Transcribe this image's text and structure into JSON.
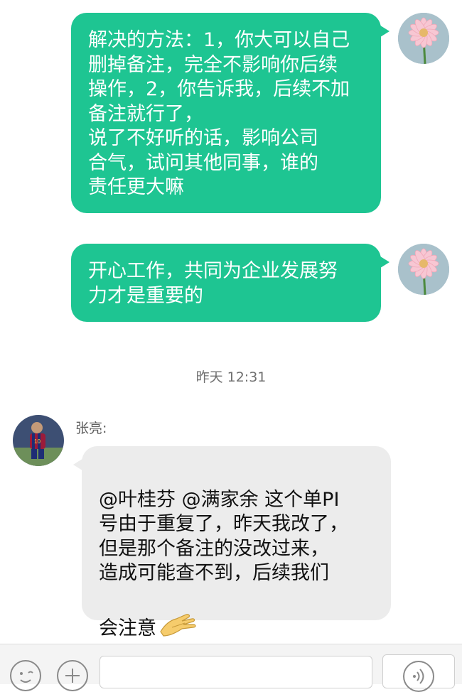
{
  "messages": [
    {
      "type": "outgoing",
      "text": "解决的方法：1，你大可以自己\n删掉备注，完全不影响你后续\n操作，2，你告诉我，后续不加\n备注就行了，\n说了不好听的话，影响公司\n合气，试问其他同事，谁的\n责任更大嘛"
    },
    {
      "type": "outgoing",
      "text": "开心工作，共同为企业发展努\n力才是重要的"
    }
  ],
  "timestamp": "昨天 12:31",
  "incoming": {
    "sender": "张亮:",
    "text_main": "@叶桂芬 @满家余 这个单PI\n号由于重复了，昨天我改了，\n但是那个备注的没改过来，\n造成可能查不到，后续我们\n",
    "text_tail": "会注意",
    "emoji": "handshake-emoji"
  },
  "toolbar": {
    "emoji_icon": "smiley-icon",
    "plus_icon": "plus-icon",
    "voice_icon": "voice-icon"
  },
  "colors": {
    "outgoing_bubble": "#1ec592",
    "incoming_bubble": "#ececec"
  }
}
